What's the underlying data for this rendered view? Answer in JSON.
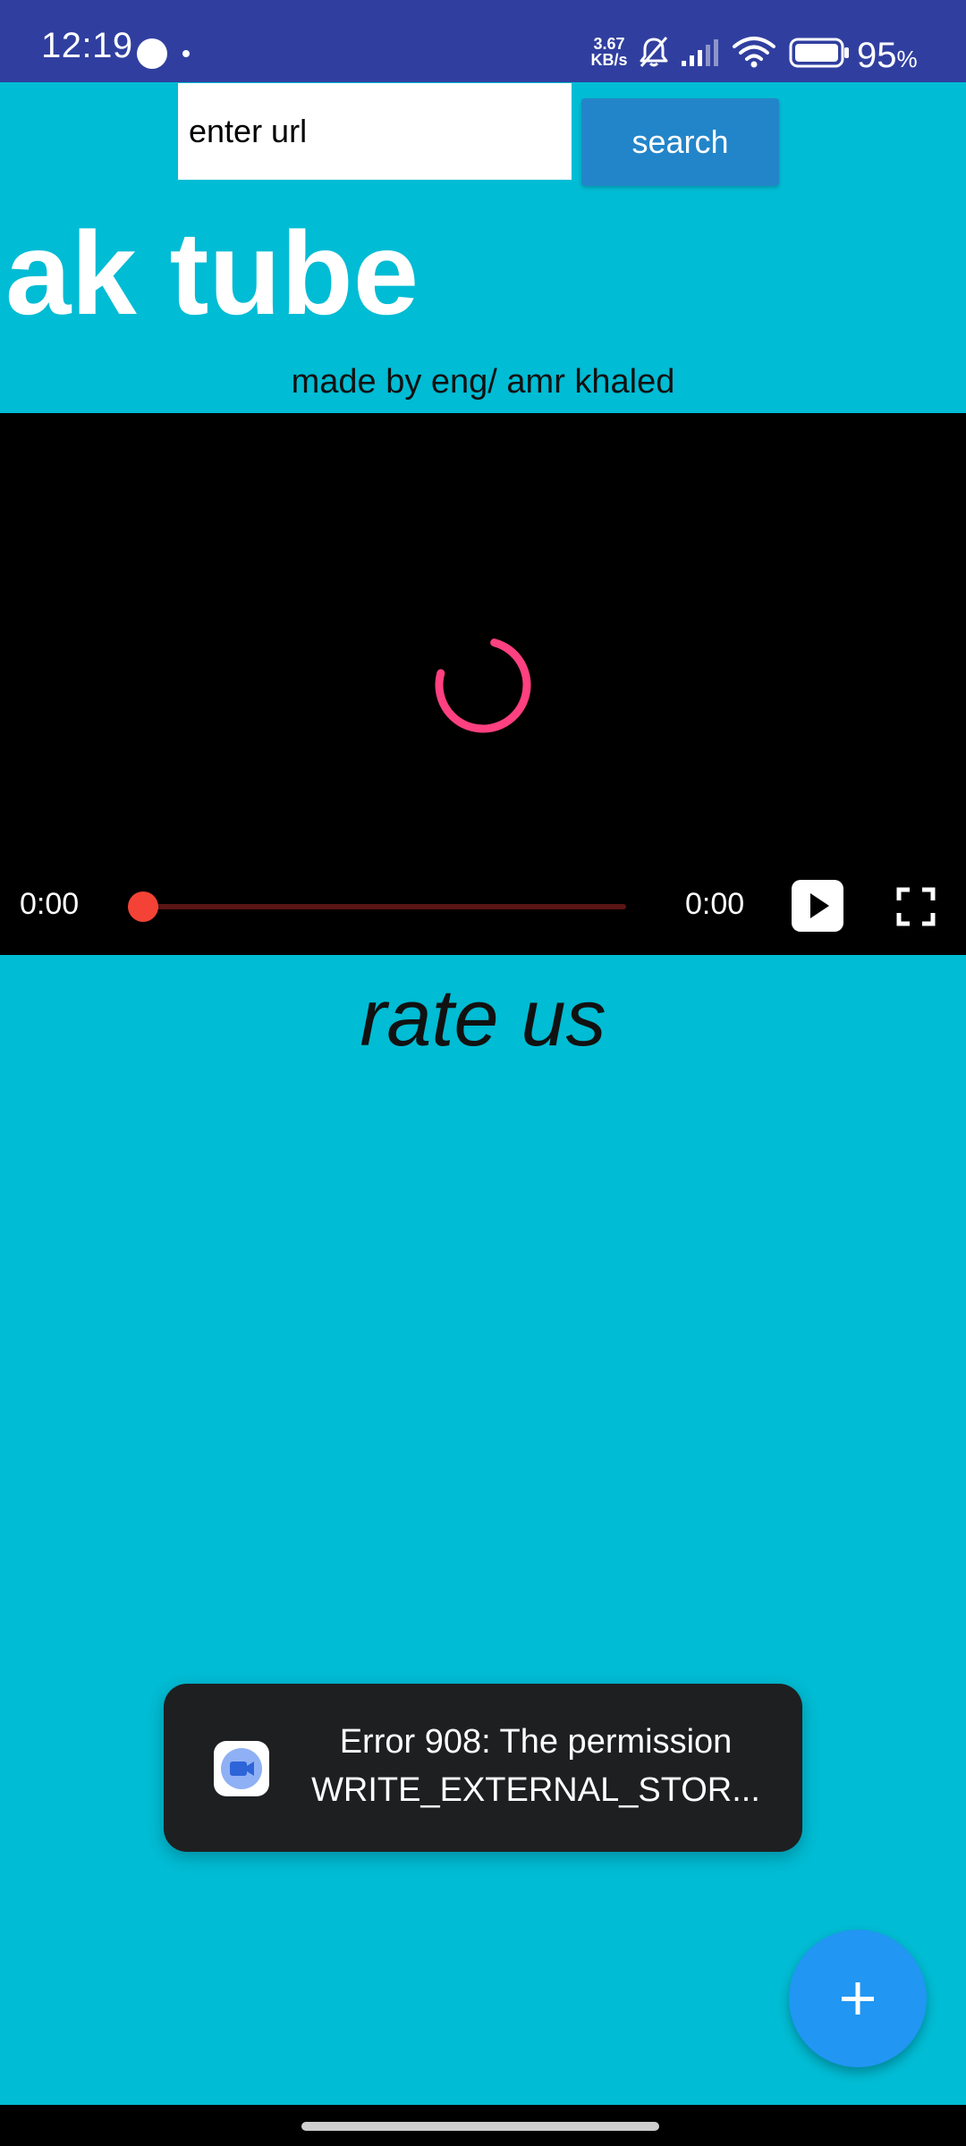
{
  "status_bar": {
    "time": "12:19",
    "network_speed_value": "3.67",
    "network_speed_unit": "KB/s",
    "battery_percent": "95",
    "battery_unit": "%",
    "icons": [
      "circle-notification-icon",
      "dot-icon",
      "bell-off-icon",
      "signal-icon",
      "wifi-icon",
      "battery-icon"
    ]
  },
  "top_bar": {
    "url_placeholder": "enter url",
    "search_label": "search"
  },
  "header": {
    "title": "ak tube",
    "credit": "made by eng/ amr khaled"
  },
  "player": {
    "current_time": "0:00",
    "total_time": "0:00",
    "progress": 0,
    "state": "loading",
    "spinner_color": "#FF4081",
    "seek_color": "#F44336"
  },
  "rate": {
    "label": "rate us"
  },
  "toast": {
    "line1": "Error 908: The permission",
    "line2": "WRITE_EXTERNAL_STOR...",
    "icon": "video-camera-icon"
  },
  "fab": {
    "symbol": "+",
    "icon": "plus-icon"
  },
  "colors": {
    "background": "#00BCD4",
    "status_bar": "#303F9F",
    "search_button": "#2385C9",
    "fab": "#2196F3"
  }
}
